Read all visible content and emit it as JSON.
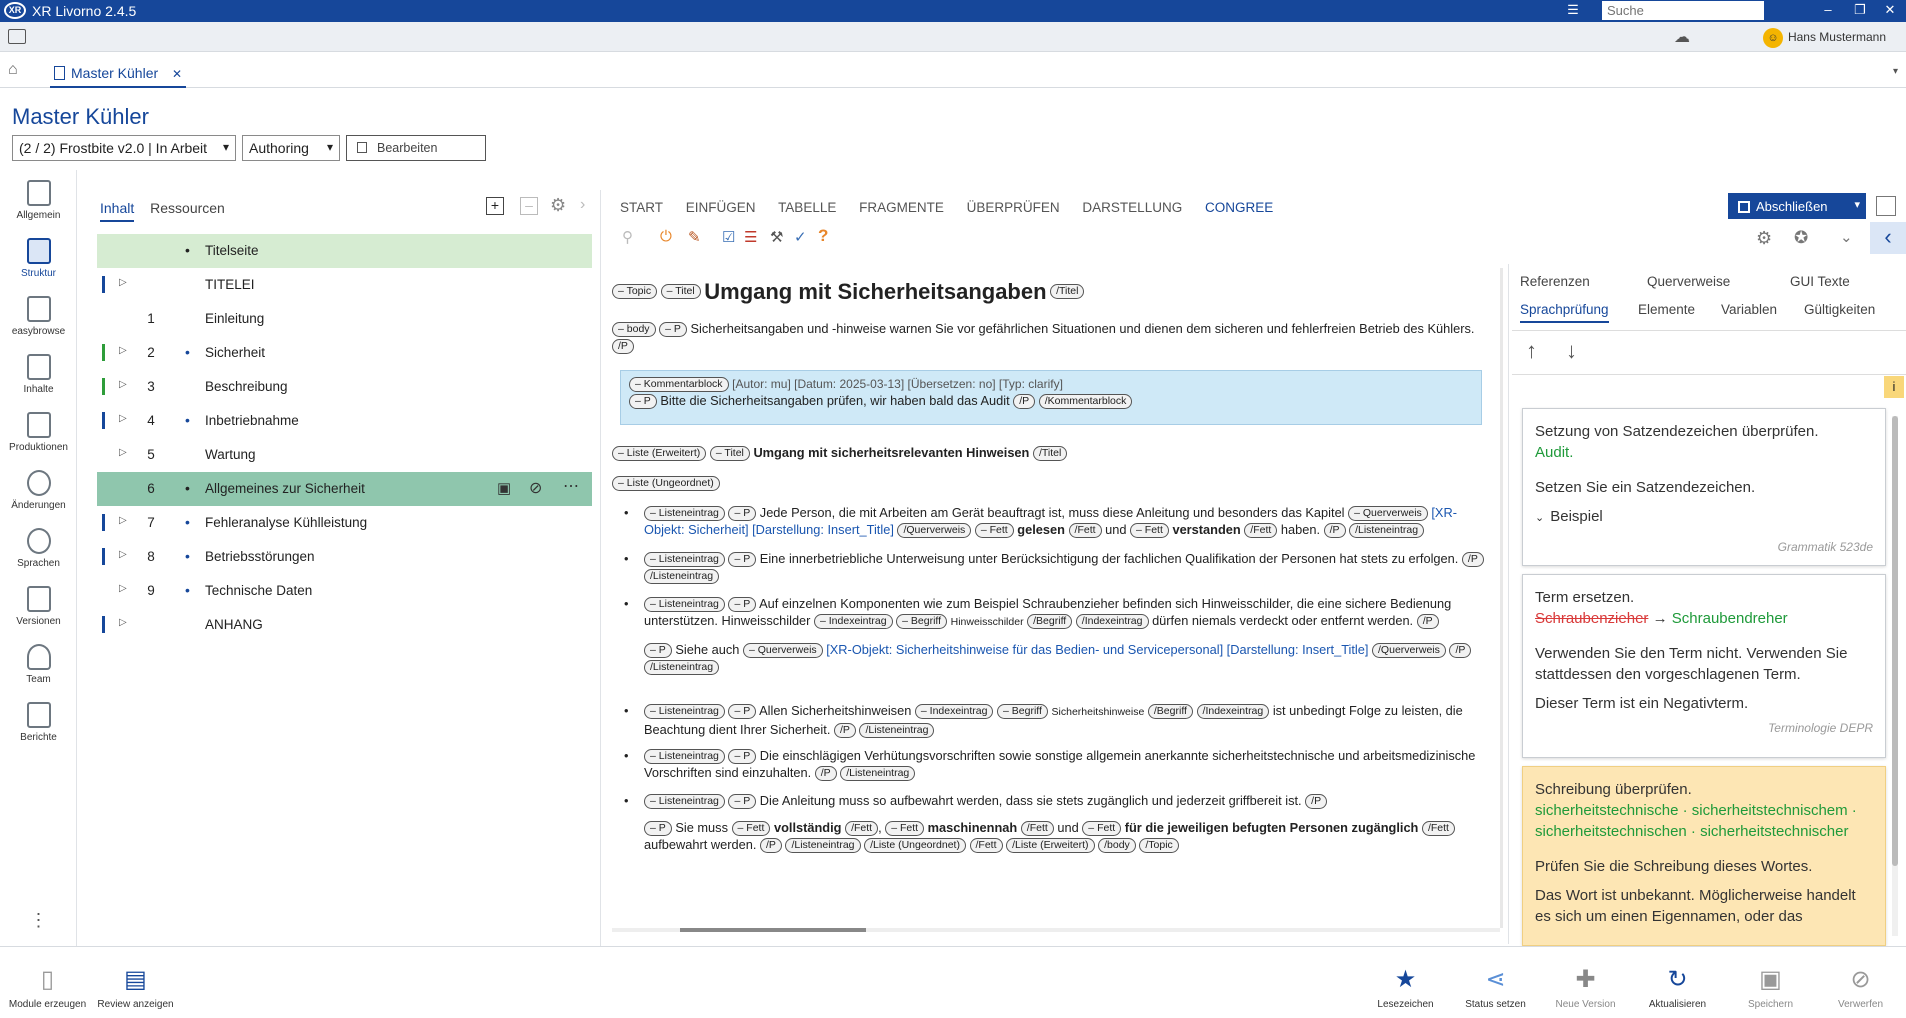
{
  "app": {
    "title": "XR Livorno 2.4.5",
    "logo": "XR",
    "search_placeholder": "Suche"
  },
  "user": {
    "name": "Hans Mustermann"
  },
  "tab": {
    "label": "Master Kühler"
  },
  "page": {
    "title": "Master Kühler",
    "version_select": "(2 / 2) Frostbite v2.0 | In Arbeit",
    "mode_select": "Authoring",
    "action_button": "Bearbeiten"
  },
  "leftnav": [
    "Allgemein",
    "Struktur",
    "easybrowse",
    "Inhalte",
    "Produktionen",
    "Änderungen",
    "Sprachen",
    "Versionen",
    "Team",
    "Berichte"
  ],
  "panel_tabs": {
    "content": "Inhalt",
    "resources": "Ressourcen"
  },
  "tree": [
    {
      "num": "",
      "label": "Titelseite",
      "dot": true
    },
    {
      "num": "",
      "label": "TITELEI",
      "dot": false
    },
    {
      "num": "1",
      "label": "Einleitung",
      "dot": false
    },
    {
      "num": "2",
      "label": "Sicherheit",
      "dot": true
    },
    {
      "num": "3",
      "label": "Beschreibung",
      "dot": false
    },
    {
      "num": "4",
      "label": "Inbetriebnahme",
      "dot": true
    },
    {
      "num": "5",
      "label": "Wartung",
      "dot": false
    },
    {
      "num": "6",
      "label": "Allgemeines zur Sicherheit",
      "dot": true
    },
    {
      "num": "7",
      "label": "Fehleranalyse Kühlleistung",
      "dot": true
    },
    {
      "num": "8",
      "label": "Betriebsstörungen",
      "dot": true
    },
    {
      "num": "9",
      "label": "Technische Daten",
      "dot": true
    },
    {
      "num": "",
      "label": "ANHANG",
      "dot": false
    }
  ],
  "ribbon": [
    "START",
    "EINFÜGEN",
    "TABELLE",
    "FRAGMENTE",
    "ÜBERPRÜFEN",
    "DARSTELLUNG",
    "CONGREE"
  ],
  "close_button": "Abschließen",
  "editor": {
    "title": "Umgang mit Sicherheitsangaben",
    "intro": "Sicherheitsangaben und -hinweise warnen Sie vor gefährlichen Situationen und dienen dem sicheren und fehlerfreien Betrieb des Kühlers.",
    "comment_meta": "[Autor: mu] [Datum: 2025-03-13] [Übersetzen: no] [Typ: clarify]",
    "comment_text": "Bitte die Sicherheitsangaben prüfen, wir haben bald das Audit",
    "subtitle": "Umgang mit sicherheitsrelevanten Hinweisen",
    "item1_a": "Jede Person, die mit Arbeiten am Gerät beauftragt ist, muss diese Anleitung und besonders das Kapitel",
    "item1_link": "[XR-Objekt: Sicherheit] [Darstellung: Insert_Title]",
    "item1_b1": "gelesen",
    "item1_b2": "und",
    "item1_b3": "verstanden",
    "item1_b4": "haben.",
    "item2": "Eine innerbetriebliche Unterweisung unter Berücksichtigung der fachlichen Qualifikation der Personen hat stets zu erfolgen.",
    "item3_a": "Auf einzelnen Komponenten wie zum Beispiel Schraubenzieher befinden sich Hinweisschilder, die eine sichere Bedienung unterstützen. Hinweisschilder",
    "item3_term": "Hinweisschilder",
    "item3_b": "dürfen niemals verdeckt oder entfernt werden.",
    "item3_see": "Siehe auch",
    "item3_link": "[XR-Objekt: Sicherheitshinweise für das Bedien- und Servicepersonal] [Darstellung: Insert_Title]",
    "item4_a": "Allen Sicherheitshinweisen",
    "item4_term": "Sicherheitshinweise",
    "item4_b": "ist unbedingt Folge zu leisten, die Beachtung dient Ihrer Sicherheit.",
    "item5": "Die einschlägigen Verhütungsvorschriften sowie sonstige allgemein anerkannte sicherheitstechnische und arbeitsmedizinische Vorschriften sind einzuhalten.",
    "item6": "Die Anleitung muss so aufbewahrt werden, dass sie stets zugänglich und jederzeit griffbereit ist.",
    "item6_p_a": "Sie muss",
    "item6_p_b1": "vollständig",
    "item6_p_b2": "maschinennah",
    "item6_p_c": "und",
    "item6_p_b3": "für die jeweiligen befugten Personen zugänglich",
    "item6_p_d": "aufbewahrt werden."
  },
  "tags": {
    "topic": "Topic",
    "titel": "Titel",
    "titel_end": "/Titel",
    "body": "body",
    "p": "P",
    "p_end": "/P",
    "kommentarblock": "Kommentarblock",
    "kommentarblock_end": "/Kommentarblock",
    "liste_erw": "Liste (Erweitert)",
    "liste_ung": "Liste (Ungeordnet)",
    "listeneintrag": "Listeneintrag",
    "listeneintrag_end": "/Listeneintrag",
    "querverweis": "Querverweis",
    "querverweis_end": "/Querverweis",
    "fett": "Fett",
    "fett_end": "/Fett",
    "indexeintrag": "Indexeintrag",
    "indexeintrag_end": "/Indexeintrag",
    "begriff": "Begriff",
    "begriff_end": "/Begriff",
    "liste_ung_end": "/Liste (Ungeordnet)",
    "liste_erw_end": "/Liste (Erweitert)",
    "body_end": "/body",
    "topic_end": "/Topic"
  },
  "right": {
    "tabs_row1": [
      "Referenzen",
      "Querverweise",
      "GUI Texte"
    ],
    "tabs_row2": [
      "Sprachprüfung",
      "Elemente",
      "Variablen",
      "Gültigkeiten"
    ],
    "info_badge": "i",
    "card1": {
      "title": "Setzung von Satzendezeichen überprüfen.",
      "fix": "Audit.",
      "hint": "Setzen Sie ein Satzendezeichen.",
      "example": "Beispiel",
      "source": "Grammatik 523de"
    },
    "card2": {
      "title": "Term ersetzen.",
      "old": "Schraubenzieher",
      "arrow": "→",
      "new": "Schraubendreher",
      "hint": "Verwenden Sie den Term nicht. Verwenden Sie stattdessen den vorgeschlagenen Term.",
      "note": "Dieser Term ist ein Negativterm.",
      "source": "Terminologie DEPR"
    },
    "card3": {
      "title": "Schreibung überprüfen.",
      "suggestions": "sicherheitstechnische · sicherheitstechnischem · sicherheitstechnischen · sicherheitstechnischer",
      "hint": "Prüfen Sie die Schreibung dieses Wortes.",
      "note": "Das Wort ist unbekannt. Möglicherweise handelt es sich um einen Eigennamen, oder das"
    }
  },
  "bottom_left": [
    "Module erzeugen",
    "Review anzeigen"
  ],
  "bottom_right": [
    "Lesezeichen",
    "Status setzen",
    "Neue Version",
    "Aktualisieren",
    "Speichern",
    "Verwerfen"
  ],
  "colors": {
    "accent": "#16479a",
    "tree_highlight": "#d6ecd2",
    "tree_selected": "#8fc6ad",
    "comment_bg": "#cfe9f7",
    "card_warning": "#fde6b4"
  }
}
